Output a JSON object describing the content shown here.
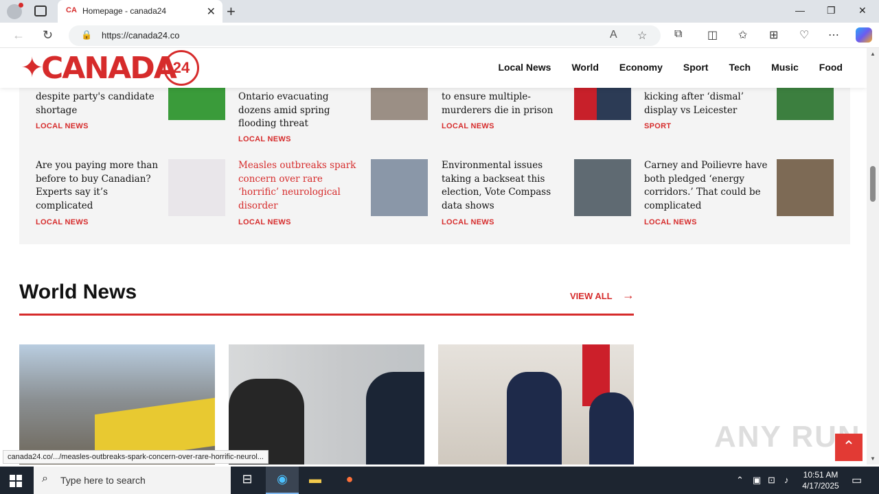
{
  "browser": {
    "tab_title": "Homepage - canada24",
    "tab_favicon": "CA",
    "url": "https://canada24.co",
    "status_link": "canada24.co/.../measles-outbreaks-spark-concern-over-rare-horrific-neurol..."
  },
  "site": {
    "logo_text": "CANADA",
    "logo_number": "24",
    "nav": [
      "Local News",
      "World",
      "Economy",
      "Sport",
      "Tech",
      "Music",
      "Food"
    ]
  },
  "cards_row1": [
    {
      "headline": "despite party's candidate shortage",
      "category": "LOCAL NEWS",
      "thumb_color": "#3a9b3a"
    },
    {
      "headline": "Ontario evacuating dozens amid spring flooding threat",
      "category": "LOCAL NEWS",
      "thumb_color": "#9b8f85"
    },
    {
      "headline": "to ensure multiple-murderers die in prison",
      "category": "LOCAL NEWS",
      "thumb_color": "#c8202a"
    },
    {
      "headline": "kicking after ‘dismal’ display vs Leicester",
      "category": "SPORT",
      "thumb_color": "#3c7f3f"
    }
  ],
  "cards_row2": [
    {
      "headline": "Are you paying more than before to buy Canadian? Experts say it’s complicated",
      "category": "LOCAL NEWS",
      "thumb_color": "#e9e6ea"
    },
    {
      "headline": "Measles outbreaks spark concern over rare ‘horrific’ neurological disorder",
      "category": "LOCAL NEWS",
      "thumb_color": "#8a97a8"
    },
    {
      "headline": "Environmental issues taking a backseat this election, Vote Compass data shows",
      "category": "LOCAL NEWS",
      "thumb_color": "#5f6a72"
    },
    {
      "headline": "Carney and Poilievre have both pledged ‘energy corridors.’ That could be complicated",
      "category": "LOCAL NEWS",
      "thumb_color": "#7d6a55"
    }
  ],
  "world": {
    "title": "World News",
    "view_all": "VIEW ALL"
  },
  "watermark": "ANY RUN",
  "taskbar": {
    "search_placeholder": "Type here to search",
    "time": "10:51 AM",
    "date": "4/17/2025"
  }
}
